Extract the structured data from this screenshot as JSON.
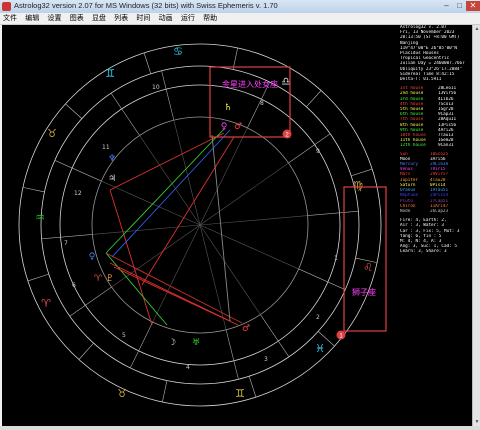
{
  "window": {
    "title": "Astrolog32 version 2.07 for MS Windows (32 bits) with Swiss Ephemeris v. 1.70",
    "minimize": "–",
    "maximize": "□",
    "close": "✕"
  },
  "menu": [
    "文件",
    "编辑",
    "设置",
    "图表",
    "显盘",
    "列表",
    "时间",
    "动画",
    "运行",
    "帮助"
  ],
  "annotations": {
    "box1_label": "金星进入处女座",
    "box1_badge": "2",
    "box2_label": "狮子座",
    "box2_badge": "1"
  },
  "house_numbers": [
    "10",
    "11",
    "12",
    "1",
    "2",
    "3",
    "4",
    "5",
    "6",
    "7",
    "8",
    "9"
  ],
  "colors": {
    "ring": "#d8d8d8",
    "highlight_box": "#e04040",
    "highlight_text": "#ff40ff",
    "cyan_sign": "#2fd0f0",
    "aspect_red": "#e03030",
    "aspect_green": "#30d030",
    "aspect_blue": "#3060f0"
  },
  "sign_icons": [
    "cancer-sign-icon",
    "leo-sign-icon",
    "virgo-sign-icon",
    "libra-sign-icon",
    "scorpio-sign-icon",
    "sagittarius-sign-icon",
    "capricorn-sign-icon",
    "aquarius-sign-icon",
    "pisces-sign-icon",
    "aries-sign-icon",
    "taurus-sign-icon",
    "gemini-sign-icon"
  ],
  "info": {
    "header": [
      "Astrolog32 v. 2.07",
      "Fri, 13 November 2023",
      "20:13:50 (ST +8:00 GMT)",
      "Nanjing",
      "119°47'00\"E 26°05'00\"N",
      "Placidus Houses",
      "Tropical Geocentric",
      "Julian Day = 2460007.7667",
      "Obliquity 23°26'17.2084\"",
      "Sidereal Time 8:42:15",
      "Delta-T: 01.5911"
    ],
    "planets": [
      {
        "name": "Sun",
        "pos": "10Sco25",
        "color": "#ff4040"
      },
      {
        "name": "Moon",
        "pos": "3Ari56",
        "color": "#ffffff"
      },
      {
        "name": "Mercury",
        "pos": "29Lib38",
        "color": "#4080ff"
      },
      {
        "name": "Venus",
        "pos": "7Vir15",
        "color": "#ff40ff"
      },
      {
        "name": "Mars",
        "pos": "29Vir57",
        "color": "#ff4040"
      },
      {
        "name": "Jupiter",
        "pos": "4Tau28",
        "color": "#ffa040"
      },
      {
        "name": "Saturn",
        "pos": "0Pis14",
        "color": "#ffff40"
      },
      {
        "name": "Uranus",
        "pos": "19Tau51",
        "color": "#40a0ff"
      },
      {
        "name": "Neptune",
        "pos": "24Pis54",
        "color": "#4040ff"
      },
      {
        "name": "Pluto",
        "pos": "27Cap51",
        "color": "#a040a0"
      },
      {
        "name": "Chiron",
        "pos": "11Ari47",
        "color": "#ff8040"
      },
      {
        "name": "Node",
        "pos": "26Cap23",
        "color": "#c0c0c0"
      }
    ],
    "houses": [
      {
        "name": "1st house",
        "pos": "28Leo11"
      },
      {
        "name": "2nd house",
        "pos": "13Vir56"
      },
      {
        "name": "3rd house",
        "pos": "4Lib26"
      },
      {
        "name": "4th house",
        "pos": "7Sco13"
      },
      {
        "name": "5th house",
        "pos": "1Sgr28"
      },
      {
        "name": "6th house",
        "pos": "9Cap31"
      },
      {
        "name": "7th house",
        "pos": "28Aqu11"
      },
      {
        "name": "8th house",
        "pos": "13Pis56"
      },
      {
        "name": "9th house",
        "pos": "4Ari26"
      },
      {
        "name": "10th house",
        "pos": "7Tau13"
      },
      {
        "name": "11th house",
        "pos": "1Gem28"
      },
      {
        "name": "12th house",
        "pos": "9Can31"
      }
    ],
    "footer": [
      "Fire: 4, Earth: 2,",
      "Air : 3, Water: 3",
      "Car : 3, Fix: 5, Mut: 3",
      "Yang: 6, Yin : 5",
      "M: 4, N: 4, A: 3",
      "Ang: 3, Suc: 1, Cad: 5",
      "Learn: 3, Share: 3"
    ]
  }
}
